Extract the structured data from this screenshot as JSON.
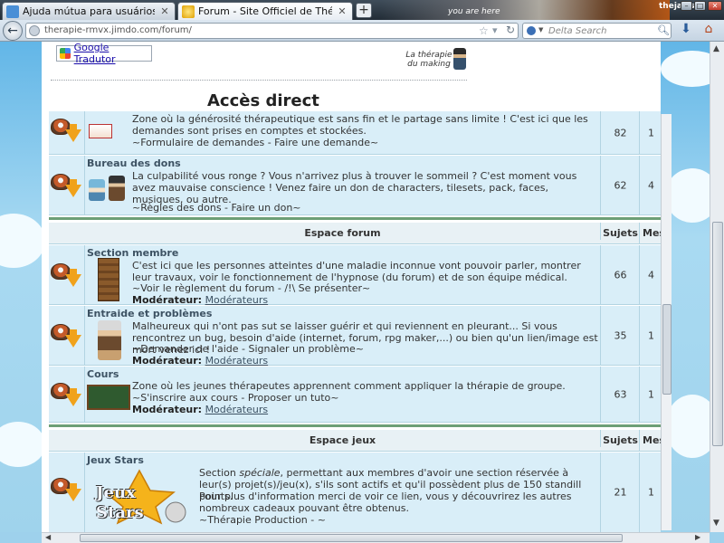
{
  "browser": {
    "tabs": [
      {
        "title": "Ajuda mútua para usuários forumeiros",
        "active": false
      },
      {
        "title": "Forum - Site Officiel de Thérapie",
        "active": true
      }
    ],
    "new_tab_symbol": "+",
    "you_are_here": "you are here",
    "username": "thejaws",
    "url": "therapie-rmvx.jimdo.com/forum/",
    "search_placeholder": "Delta Search",
    "icons": {
      "back": "back-arrow-icon",
      "bookmark": "star-icon",
      "reload": "reload-icon",
      "search": "magnifier-icon",
      "download": "download-arrow-icon",
      "home": "home-icon"
    }
  },
  "page": {
    "translator_label": "Google Tradutor",
    "logo_text": "La thérapie du making",
    "title": "Accès direct",
    "forum": {
      "rows_top": [
        {
          "id": "demandes",
          "title": "",
          "desc": "Zone où la générosité thérapeutique est sans fin et le partage sans limite ! C'est ici que les demandes sont prises en comptes et stockées.",
          "links": "~Formulaire de demandes - Faire une demande~",
          "subjects": "82",
          "messages": "1"
        },
        {
          "id": "dons",
          "title": "Bureau des dons",
          "desc": "La culpabilité vous ronge ? Vous n'arrivez plus à trouver le sommeil ? C'est moment vous avez mauvaise conscience ! Venez faire un don de characters, tilesets, pack, faces, musiques, ou autre.",
          "links": "~Règles des dons - Faire un don~",
          "subjects": "62",
          "messages": "4"
        }
      ],
      "categories": [
        {
          "name": "Espace forum",
          "col_subjects": "Sujets",
          "col_messages": "Mes",
          "rows": [
            {
              "title": "Section membre",
              "desc": "C'est ici que les personnes atteintes d'une maladie inconnue vont pouvoir parler, montrer leur travaux, voir le fonctionnement de l'hypnose (du forum) et de son équipe médical.",
              "links": "~Voir le règlement du forum - /!\\ Se présenter~",
              "mod_label": "Modérateur:",
              "mod_link": "Modérateurs",
              "subjects": "66",
              "messages": "4"
            },
            {
              "title": "Entraide et problèmes",
              "desc": "Malheureux qui n'ont pas sut se laisser guérir et qui reviennent en pleurant... Si vous rencontrez un bug, besoin d'aide (internet, forum, rpg maker,...) ou bien qu'un lien/image est mort venez ici !",
              "links": "~Demander de l'aide - Signaler un problème~",
              "mod_label": "Modérateur:",
              "mod_link": "Modérateurs",
              "subjects": "35",
              "messages": "1"
            },
            {
              "title": "Cours",
              "desc": "Zone où les jeunes thérapeutes apprennent comment appliquer la thérapie de groupe.",
              "links": "~S'inscrire aux cours - Proposer un tuto~",
              "mod_label": "Modérateur:",
              "mod_link": "Modérateurs",
              "subjects": "63",
              "messages": "1"
            }
          ]
        },
        {
          "name": "Espace jeux",
          "col_subjects": "Sujets",
          "col_messages": "Mes",
          "rows": [
            {
              "title": "Jeux Stars",
              "banner_text": "Jeux Stars",
              "desc_pre": "Section ",
              "desc_em": "spéciale",
              "desc_post": ", permettant aux membres d'avoir une section réservée à leur(s) projet(s)/jeu(x), s'ils sont actifs et qu'il possèdent plus de 150 standill points.",
              "desc2": "Pour plus d'information merci de voir ce lien, vous y découvrirez les autres nombreux cadeaux pouvant être obtenus.",
              "links": "~Thérapie Production - ~",
              "subjects": "21",
              "messages": "1"
            }
          ]
        }
      ]
    }
  }
}
